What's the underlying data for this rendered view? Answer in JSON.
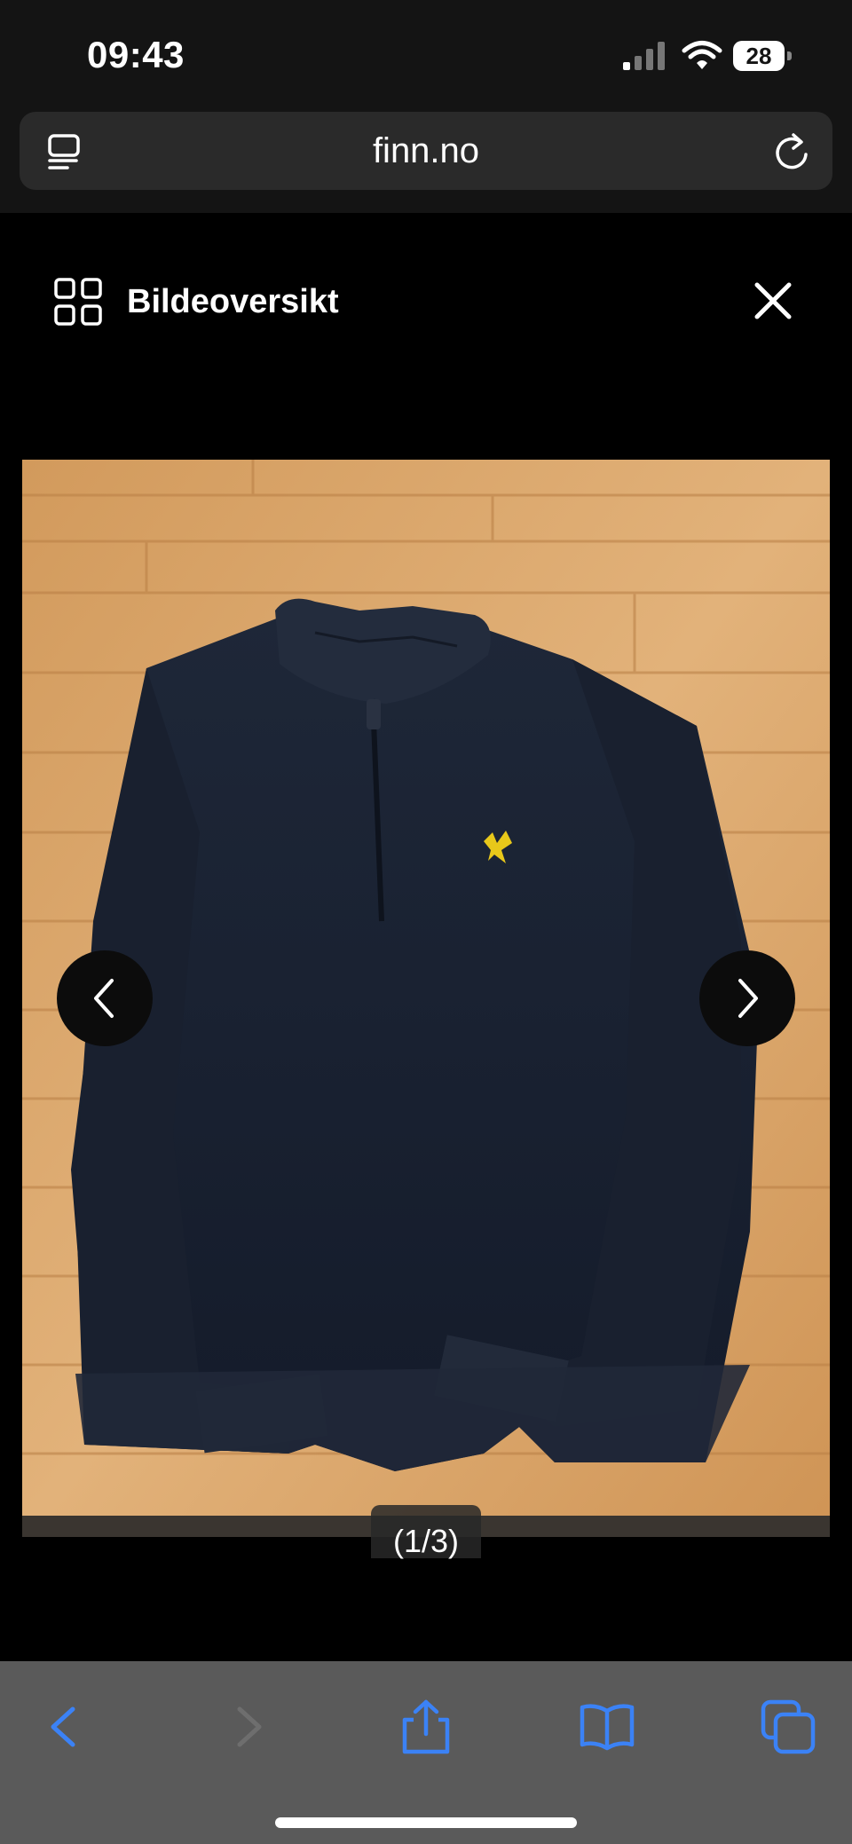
{
  "status_bar": {
    "time": "09:43",
    "battery_level": "28",
    "icons": [
      "cellular-signal-icon",
      "wifi-icon",
      "battery-icon"
    ]
  },
  "browser": {
    "url": "finn.no",
    "icons": [
      "reader-mode-icon",
      "reload-icon"
    ]
  },
  "viewer": {
    "title": "Bildeoversikt",
    "counter": "(1/3)",
    "icons": [
      "grid-icon",
      "close-icon",
      "chevron-left-icon",
      "chevron-right-icon"
    ]
  },
  "toolbar": {
    "icons": [
      "back-icon",
      "forward-icon",
      "share-icon",
      "bookmarks-icon",
      "tabs-icon"
    ]
  },
  "colors": {
    "status_bg": "#141414",
    "viewer_bg": "#000000",
    "toolbar_bg": "#5a5a5a",
    "accent_blue": "#3b82f6",
    "sweater_navy": "#1a2233",
    "logo_yellow": "#e8c81a",
    "wood": "#d9a466"
  }
}
